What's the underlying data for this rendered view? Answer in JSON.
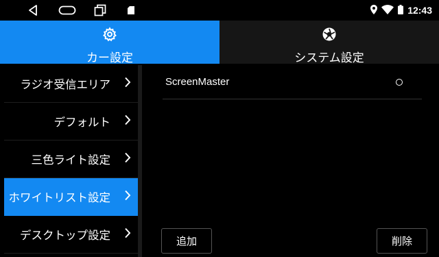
{
  "statusbar": {
    "time": "12:43",
    "icons": [
      "back-icon",
      "home-icon",
      "recents-icon",
      "sd-card-icon",
      "location-icon",
      "wifi-icon",
      "battery-icon"
    ]
  },
  "tabs": [
    {
      "label": "カー設定",
      "icon": "gear-icon",
      "active": true
    },
    {
      "label": "システム設定",
      "icon": "system-icon",
      "active": false
    }
  ],
  "sidebar": {
    "items": [
      {
        "label": "ラジオ受信エリア",
        "active": false
      },
      {
        "label": "デフォルト",
        "active": false
      },
      {
        "label": "三色ライト設定",
        "active": false
      },
      {
        "label": "ホワイトリスト設定",
        "active": true
      },
      {
        "label": "デスクトップ設定",
        "active": false
      }
    ]
  },
  "main": {
    "list": [
      {
        "name": "ScreenMaster",
        "selected": false
      }
    ],
    "add_label": "追加",
    "delete_label": "削除"
  },
  "colors": {
    "accent": "#1389f2",
    "background": "#000000",
    "inactive_tab": "#161616"
  }
}
